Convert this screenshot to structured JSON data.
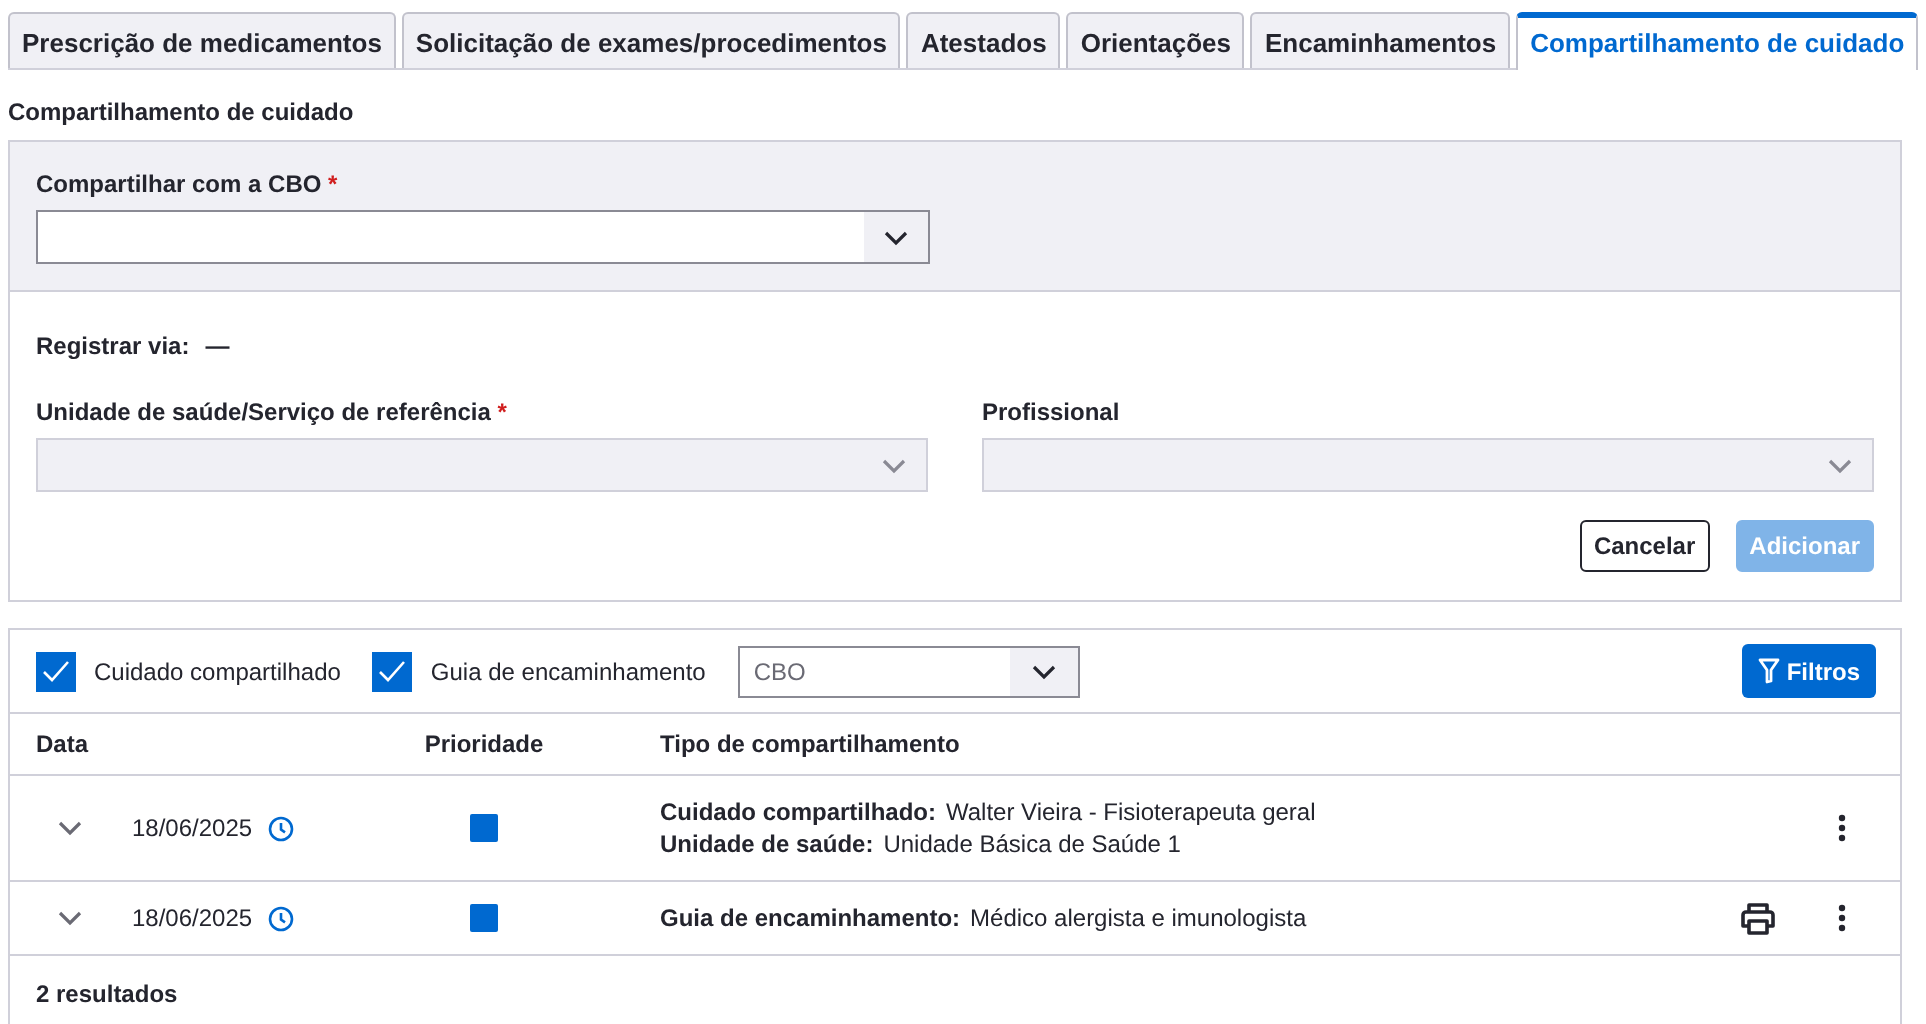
{
  "tabs": [
    {
      "label": "Prescrição de medicamentos",
      "selected": false
    },
    {
      "label": "Solicitação de exames/procedimentos",
      "selected": false
    },
    {
      "label": "Atestados",
      "selected": false
    },
    {
      "label": "Orientações",
      "selected": false
    },
    {
      "label": "Encaminhamentos",
      "selected": false
    },
    {
      "label": "Compartilhamento de cuidado",
      "selected": true
    }
  ],
  "section_title": "Compartilhamento de cuidado",
  "form": {
    "cbo_field": {
      "label": "Compartilhar com a CBO",
      "required_mark": "*",
      "disabled": false
    },
    "register_via": {
      "label": "Registrar via:",
      "value": "—"
    },
    "fields": [
      {
        "label": "Unidade de saúde/Serviço de referência",
        "required_mark": "*",
        "disabled": true
      },
      {
        "label": "Profissional",
        "disabled": true
      }
    ],
    "buttons": [
      {
        "label": "Cancelar",
        "kind": "secondary",
        "disabled": false
      },
      {
        "label": "Adicionar",
        "kind": "primary",
        "disabled": true
      }
    ]
  },
  "results": {
    "checkboxes": [
      {
        "label": "Cuidado compartilhado",
        "checked": true
      },
      {
        "label": "Guia de encaminhamento",
        "checked": true
      }
    ],
    "cbo_select": {
      "placeholder": "CBO"
    },
    "filter_button": "Filtros",
    "columns": [
      "Data",
      "Prioridade",
      "Tipo de compartilhamento"
    ],
    "rows": [
      {
        "date": "18/06/2025",
        "color": "#0069d0",
        "printable": false,
        "lines": [
          {
            "label": "Cuidado compartilhado:",
            "value": "Walter Vieira - Fisioterapeuta geral"
          },
          {
            "label": "Unidade de saúde:",
            "value": "Unidade Básica de Saúde 1"
          }
        ]
      },
      {
        "date": "18/06/2025",
        "color": "#0069d0",
        "printable": true,
        "lines": [
          {
            "label": "Guia de encaminhamento:",
            "value": "Médico alergista e imunologista"
          }
        ]
      }
    ],
    "footer": "2 resultados"
  }
}
